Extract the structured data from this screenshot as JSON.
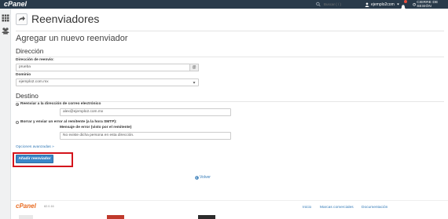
{
  "topbar": {
    "logo": "cPanel",
    "search_placeholder": "Buscar ( / )",
    "user": "ejemplo2com",
    "logout": "CIERRE DE SESIÓN"
  },
  "page": {
    "title": "Reenviadores",
    "subtitle": "Agregar un nuevo reenviador"
  },
  "address": {
    "heading": "Dirección",
    "forward_label": "Dirección de reenvío:",
    "forward_value": "prueba",
    "at_sign": "@",
    "domain_label": "Dominio",
    "domain_value": "ejemplo2.com.mx"
  },
  "destination": {
    "heading": "Destino",
    "option1_label": "Reenviar a la dirección de correo electrónico",
    "option1_value": "alex@ejemplo2.com.mx",
    "option2_label": "Borrar y enviar un error al remitente (a la hora SMTP):",
    "error_label": "Mensaje de error (visto por el remitente)",
    "error_value": "No existe dicha persona en esta dirección."
  },
  "actions": {
    "advanced": "Opciones avanzadas »",
    "add_button": "Añadir reenviador",
    "back": "Volver"
  },
  "footer": {
    "logo": "cPanel",
    "version": "82.0.16",
    "links": [
      "Inicio",
      "Marcas comerciales",
      "Documentación"
    ]
  },
  "colors": {
    "topbar": "#293a4a",
    "link": "#337ab7",
    "button": "#3a87c8",
    "highlight": "#d4141c",
    "cpanel_orange": "#e86a1f"
  }
}
